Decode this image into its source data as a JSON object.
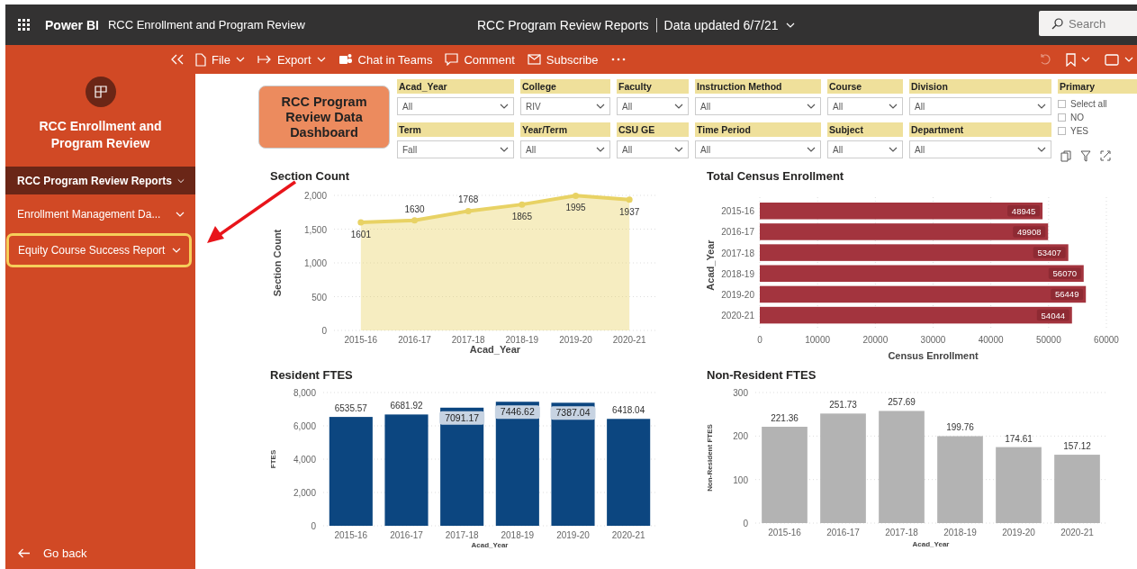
{
  "app_bar": {
    "app_name": "Power BI",
    "report_name": "RCC Enrollment and Program Review",
    "report_title": "RCC Program Review Reports",
    "data_updated": "Data updated 6/7/21",
    "search": {
      "placeholder": "Search"
    }
  },
  "toolbar": {
    "items": [
      {
        "label": "File",
        "kind": "menu"
      },
      {
        "label": "Export",
        "kind": "menu"
      },
      {
        "label": "Chat in Teams",
        "kind": "button"
      },
      {
        "label": "Comment",
        "kind": "button"
      },
      {
        "label": "Subscribe",
        "kind": "button"
      }
    ]
  },
  "sidebar": {
    "title": "RCC Enrollment and Program Review",
    "pages": [
      {
        "label": "RCC Program Review Reports",
        "selected": true,
        "highlighted": false
      },
      {
        "label": "Enrollment Management Da...",
        "selected": false,
        "highlighted": false
      },
      {
        "label": "Equity Course Success Report",
        "selected": false,
        "highlighted": true
      }
    ],
    "back": "Go back"
  },
  "dashboard": {
    "title": "RCC Program Review Data Dashboard",
    "slicers": [
      {
        "label": "Acad_Year",
        "value": "All"
      },
      {
        "label": "College",
        "value": "RIV"
      },
      {
        "label": "Faculty",
        "value": "All"
      },
      {
        "label": "Instruction Method",
        "value": "All"
      },
      {
        "label": "Course",
        "value": "All"
      },
      {
        "label": "Division",
        "value": "All"
      },
      {
        "label": "Term",
        "value": "Fall"
      },
      {
        "label": "Year/Term",
        "value": "All"
      },
      {
        "label": "CSU GE",
        "value": "All"
      },
      {
        "label": "Time Period",
        "value": "All"
      },
      {
        "label": "Subject",
        "value": "All"
      },
      {
        "label": "Department",
        "value": "All"
      }
    ],
    "primary": {
      "label": "Primary",
      "options": [
        {
          "label": "Select all",
          "checked": false
        },
        {
          "label": "NO",
          "checked": false
        },
        {
          "label": "YES",
          "checked": false
        }
      ]
    },
    "charts": [
      {
        "chart_data": {
          "type": "area",
          "title": "Section Count",
          "xlabel": "Acad_Year",
          "ylabel": "Section Count",
          "categories": [
            "2015-16",
            "2016-17",
            "2017-18",
            "2018-19",
            "2019-20",
            "2020-21"
          ],
          "grid": true,
          "series": [
            {
              "color": "#e8d264",
              "values": [
                1601,
                1630,
                1768,
                1865,
                1995,
                1937
              ]
            }
          ],
          "ylim": [
            0,
            2000
          ],
          "yticks": [
            0,
            500,
            {
              "value": 1000,
              "label": "1,000"
            },
            {
              "value": 1500,
              "label": "1,500"
            },
            {
              "value": 2000,
              "label": "2,000"
            }
          ],
          "data_labels": true
        }
      },
      {
        "chart_data": {
          "type": "bar",
          "orientation": "horizontal",
          "title": "Total Census Enrollment",
          "xlabel": "Census Enrollment",
          "ylabel": "Acad_Year",
          "categories": [
            "2015-16",
            "2016-17",
            "2017-18",
            "2018-19",
            "2019-20",
            "2020-21"
          ],
          "grid": true,
          "series": [
            {
              "color": "#a3343e",
              "values": [
                48945,
                49908,
                53407,
                56070,
                56449,
                54044
              ]
            }
          ],
          "xlim": [
            0,
            60000
          ],
          "xticks": [
            0,
            10000,
            20000,
            30000,
            40000,
            50000,
            60000
          ],
          "data_labels": true
        }
      },
      {
        "chart_data": {
          "type": "bar",
          "orientation": "vertical",
          "title": "Resident FTES",
          "xlabel": "Acad_Year",
          "ylabel": "FTES",
          "categories": [
            "2015-16",
            "2016-17",
            "2017-18",
            "2018-19",
            "2019-20",
            "2020-21"
          ],
          "grid": true,
          "series": [
            {
              "color": "#0c4680",
              "values": [
                6535.57,
                6681.92,
                7091.17,
                7446.62,
                7387.04,
                6418.04
              ]
            }
          ],
          "ylim": [
            0,
            8000
          ],
          "yticks": [
            0,
            {
              "value": 2000,
              "label": "2,000"
            },
            {
              "value": 4000,
              "label": "4,000"
            },
            {
              "value": 6000,
              "label": "6,000"
            },
            {
              "value": 8000,
              "label": "8,000"
            }
          ],
          "data_labels": true
        }
      },
      {
        "chart_data": {
          "type": "bar",
          "orientation": "vertical",
          "title": "Non-Resident FTES",
          "xlabel": "Acad_Year",
          "ylabel": "Non-Resident FTES",
          "categories": [
            "2015-16",
            "2016-17",
            "2017-18",
            "2018-19",
            "2019-20",
            "2020-21"
          ],
          "grid": true,
          "series": [
            {
              "color": "#b3b3b3",
              "values": [
                221.36,
                251.73,
                257.69,
                199.76,
                174.61,
                157.12
              ]
            }
          ],
          "ylim": [
            0,
            300
          ],
          "yticks": [
            0,
            100,
            200,
            300
          ],
          "data_labels": true
        }
      }
    ]
  }
}
